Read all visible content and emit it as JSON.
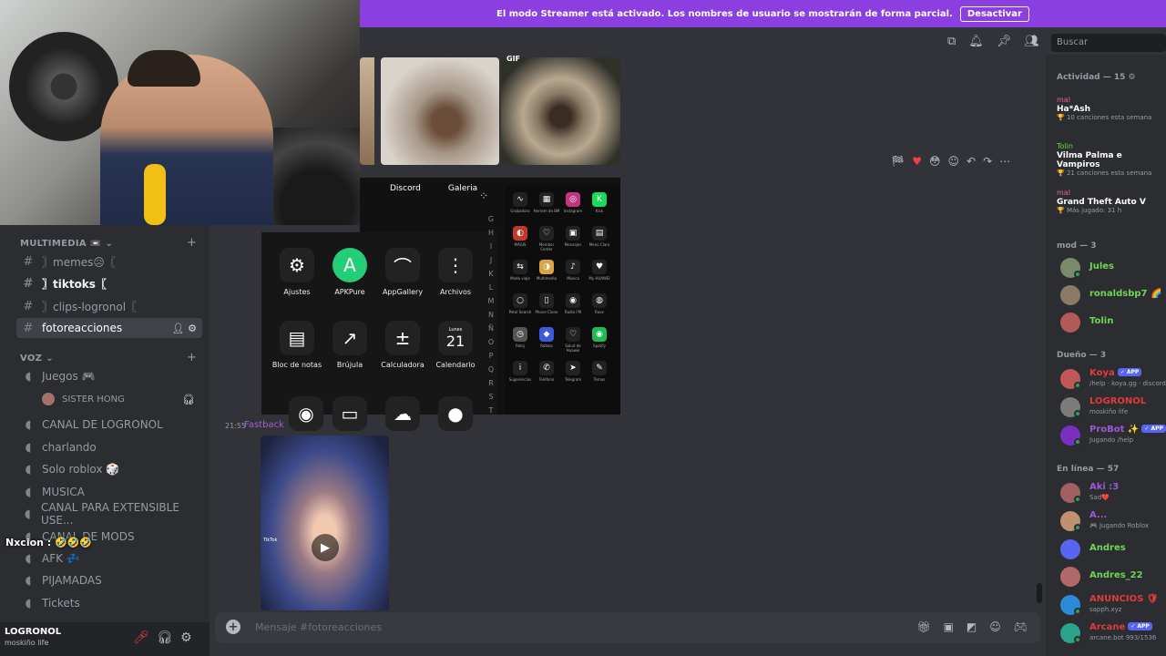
{
  "banner": {
    "text": "El modo Streamer está activado. Los nombres de usuario se mostrarán de forma parcial.",
    "button": "Desactivar"
  },
  "search": {
    "placeholder": "Buscar"
  },
  "sidebar": {
    "multimedia_header": "MULTIMEDIA 📼",
    "voz_header": "VOZ",
    "text_channels": [
      {
        "icon": "#",
        "label": "〗memes😥〖"
      },
      {
        "icon": "#",
        "label": "〗tiktoks〖"
      },
      {
        "icon": "#",
        "label": "〗clips-logronol〖"
      },
      {
        "icon": "#",
        "label": "fotoreacciones"
      }
    ],
    "voice_channels": [
      {
        "label": "Juegos 🎮"
      },
      {
        "label": "SISTER HONG"
      },
      {
        "label": "CANAL DE LOGRONOL"
      },
      {
        "label": "charlando"
      },
      {
        "label": "Solo roblox 🎲"
      },
      {
        "label": "MUSICA"
      },
      {
        "label": "CANAL PARA EXTENSIBLE USE..."
      },
      {
        "label": "CANAL DE MODS"
      },
      {
        "label": "AFK 💤"
      },
      {
        "label": "PIJAMADAS"
      },
      {
        "label": "Tickets"
      }
    ],
    "overlay_chat": "Nxcion : 🤣🤣🤣"
  },
  "user": {
    "name": "LOGRONOL",
    "status": "moskiño life"
  },
  "phone": {
    "tabs": [
      "Discord",
      "Galeria"
    ],
    "apps": [
      {
        "label": "Ajustes",
        "icon": "⚙"
      },
      {
        "label": "APKPure",
        "icon": "A"
      },
      {
        "label": "AppGallery",
        "icon": "⌒"
      },
      {
        "label": "Archivos",
        "icon": "⋮"
      },
      {
        "label": "Bloc de notas",
        "icon": "▤"
      },
      {
        "label": "Brújula",
        "icon": "↗"
      },
      {
        "label": "Calculadora",
        "icon": "±"
      },
      {
        "label": "Calendario",
        "icon": "21"
      }
    ],
    "calendar_day": "Lunes",
    "letters": [
      "G",
      "H",
      "I",
      "J",
      "K",
      "L",
      "M",
      "N",
      "Ñ",
      "O",
      "P",
      "Q",
      "R",
      "S",
      "T"
    ],
    "mini_apps": [
      "Grabadora",
      "Herram de BM",
      "Instagram",
      "Kick",
      "MAGIS",
      "Member Center",
      "Mensajes",
      "Menú Claro",
      "Modo viaje",
      "Multimedia",
      "Música",
      "My HUAWEI",
      "Petal Search",
      "Phone Clone",
      "Radio FM",
      "Rave",
      "Reloj",
      "Roblox",
      "Salud de Huawei",
      "Spotify",
      "Sugerencias",
      "Teléfono",
      "Telegram",
      "Temas"
    ]
  },
  "image_tag": "GIF",
  "message": {
    "time": "21:55",
    "author": "Fastback",
    "tiktok": "TikTok"
  },
  "composer": {
    "placeholder": "Mensaje #fotoreacciones"
  },
  "members": {
    "activity_header": "Actividad — 15 ⚙",
    "activities": [
      {
        "user": "mal",
        "title": "Ha*Ash",
        "sub": "🏆 10 canciones esta semana"
      },
      {
        "user": "Tolin",
        "title": "Vilma Palma e Vampiros",
        "sub": "🏆 21 canciones esta semana"
      },
      {
        "user": "mal",
        "title": "Grand Theft Auto V",
        "sub": "🏆 Más jugado: 31 h"
      }
    ],
    "mod_header": "mod — 3",
    "mods": [
      {
        "name": "Jules",
        "color": "#6fd653"
      },
      {
        "name": "ronaldsbp7 🌈",
        "color": "#6fd653"
      },
      {
        "name": "Tolin",
        "color": "#6fd653"
      }
    ],
    "owner_header": "Dueño — 3",
    "owners": [
      {
        "name": "Koya",
        "badge": "✓ APP",
        "sub": "/help · koya.gg · discord",
        "color": "#e03b3b"
      },
      {
        "name": "LOGRONOL",
        "badge": "",
        "sub": "moskiño life",
        "color": "#e03b3b"
      },
      {
        "name": "ProBot ✨",
        "badge": "✓ APP",
        "sub": "Jugando /help",
        "color": "#9b59d6"
      }
    ],
    "online_header": "En línea — 57",
    "online": [
      {
        "name": "Aki :3",
        "sub": "Sad❤️",
        "color": "#9b59d6"
      },
      {
        "name": "A...",
        "sub": "🎮 Jugando Roblox",
        "color": "#9b59d6"
      },
      {
        "name": "Andres",
        "sub": "",
        "color": "#6fd653"
      },
      {
        "name": "Andres_22",
        "sub": "",
        "color": "#6fd653"
      },
      {
        "name": "ANUNCIOS 🛡",
        "sub": "sapph.xyz",
        "color": "#e03b3b"
      },
      {
        "name": "Arcane",
        "badge": "✓ APP",
        "sub": "arcane.bot 993/1536",
        "color": "#e03b3b"
      }
    ]
  },
  "colors": {
    "banner": "#8b3fe0",
    "online": "#23a55a",
    "accent": "#5865f2"
  }
}
